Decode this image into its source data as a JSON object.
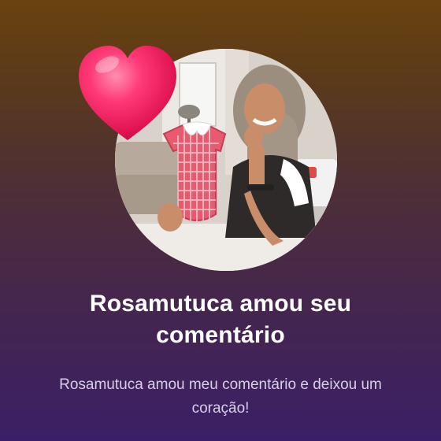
{
  "notification": {
    "title": "Rosamutuca amou seu comentário",
    "message": "Rosamutuca amou meu comentário e deixou um coração!"
  },
  "reaction": {
    "icon": "heart-icon",
    "color": "#ff2a6a"
  },
  "colors": {
    "background_top": "#6a420f",
    "background_bottom": "#3b1f66",
    "title_text": "#ffffff",
    "subtitle_text": "#d9cfe6"
  }
}
